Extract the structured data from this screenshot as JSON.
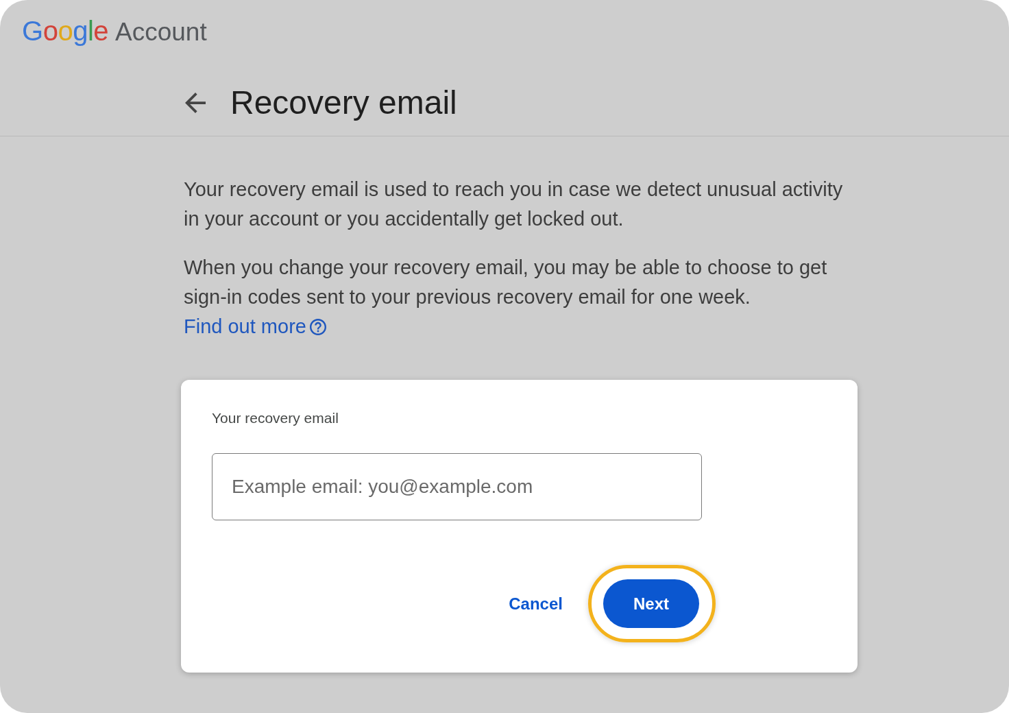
{
  "header": {
    "logo_text": "Google",
    "product_name": "Account"
  },
  "page_header": {
    "title": "Recovery email"
  },
  "description": [
    {
      "text": "Your recovery email is used to reach you in case we detect unusual activity in your account or you accidentally get locked out."
    },
    {
      "text": "When you change your recovery email, you may be able to choose to get sign-in codes sent to your previous recovery email for one week.",
      "link": "Find out more"
    }
  ],
  "form": {
    "label": "Your recovery email",
    "placeholder": "Example email: you@example.com",
    "actions": [
      {
        "label": "Cancel",
        "kind": "text",
        "focused": false
      },
      {
        "label": "Next",
        "kind": "filled",
        "focused": true
      }
    ]
  }
}
